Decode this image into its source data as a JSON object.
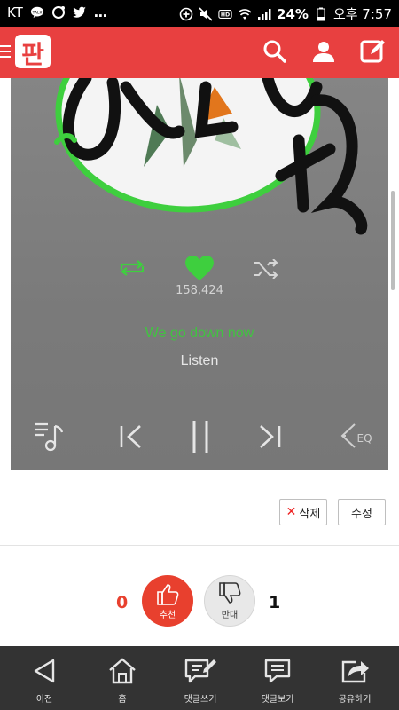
{
  "status_bar": {
    "carrier": "KT",
    "ellipsis": "…",
    "battery": "24%",
    "time": "오후 7:57",
    "icons": [
      "talk-icon",
      "chat-bubble-icon",
      "twitter-icon",
      "data-saver-icon",
      "mute-icon",
      "hd-icon",
      "wifi-icon",
      "signal-icon",
      "battery-icon"
    ]
  },
  "app_bar": {
    "logo_text": "판",
    "icons": [
      "menu-icon",
      "search-icon",
      "person-icon",
      "edit-icon"
    ],
    "color": "#e84040"
  },
  "player": {
    "likes": "158,424",
    "song": "We go down now",
    "artist": "Listen",
    "icons": [
      "repeat-icon",
      "heart-icon",
      "shuffle-icon",
      "playlist-icon",
      "previous-icon",
      "pause-icon",
      "next-icon",
      "eq-icon"
    ],
    "eq_label": "EQ",
    "accent": "#41c341"
  },
  "actions": {
    "delete_label": "삭제",
    "edit_label": "수정"
  },
  "votes": {
    "up_count": "0",
    "up_label": "추천",
    "down_label": "반대",
    "down_count": "1",
    "up_color": "#e8402e"
  },
  "bottom_nav": {
    "prev_label": "이전",
    "home_label": "홈",
    "write_comment_label": "댓글쓰기",
    "view_comments_label": "댓글보기",
    "share_label": "공유하기"
  }
}
